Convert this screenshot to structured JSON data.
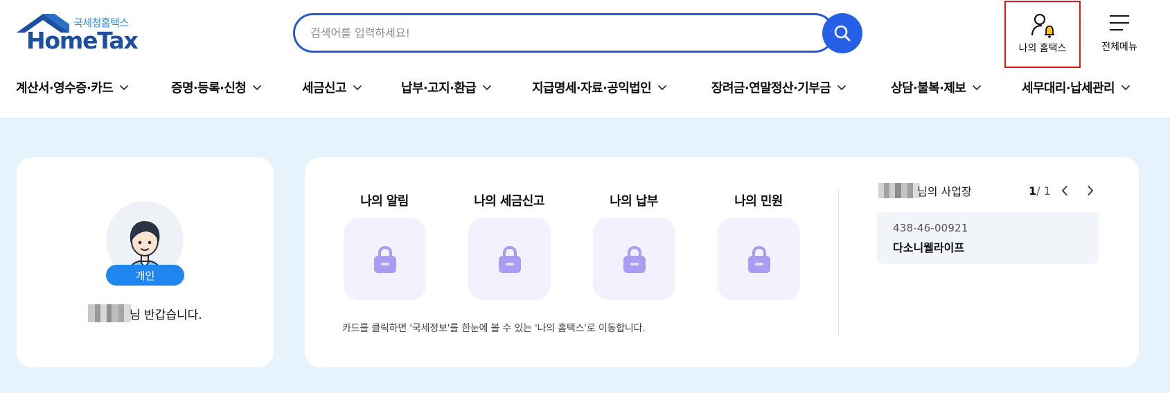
{
  "header": {
    "logo": {
      "sub": "국세청홈택스",
      "main": "HomeTax"
    },
    "search": {
      "placeholder": "검색어를 입력하세요!"
    },
    "my_hometax_label": "나의 홈택스",
    "all_menu_label": "전체메뉴"
  },
  "nav": [
    {
      "label": "계산서·영수증·카드"
    },
    {
      "label": "증명·등록·신청"
    },
    {
      "label": "세금신고"
    },
    {
      "label": "납부·고지·환급"
    },
    {
      "label": "지급명세·자료·공익법인"
    },
    {
      "label": "장려금·연말정산·기부금"
    },
    {
      "label": "상담·불복·제보"
    },
    {
      "label": "세무대리·납세관리"
    }
  ],
  "profile": {
    "badge": "개인",
    "greeting_suffix": "님 반갑습니다."
  },
  "tiles": [
    {
      "title": "나의 알림"
    },
    {
      "title": "나의 세금신고"
    },
    {
      "title": "나의 납부"
    },
    {
      "title": "나의 민원"
    }
  ],
  "tile_note": "카드를 클릭하면 '국세정보'를 한눈에 볼 수 있는 '나의 홈택스'로 이동합니다.",
  "business": {
    "title_suffix": "님의 사업장",
    "page_current": "1",
    "page_total": " / 1",
    "reg_no": "438-46-00921",
    "name": "다소니웰라이프"
  },
  "colors": {
    "accent": "#2660e6",
    "badge": "#1f86f0",
    "highlight_box": "#e5141a",
    "page_bg": "#e6f2fc",
    "tile_bg": "#f3f1fd",
    "lock": "#a99cf2"
  }
}
